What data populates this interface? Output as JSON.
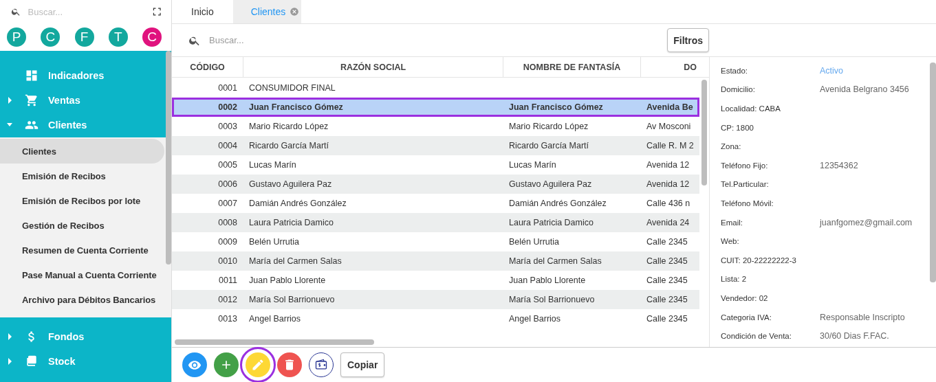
{
  "sidebar": {
    "search": {
      "placeholder": "Buscar..."
    },
    "shortcuts": [
      {
        "letter": "P",
        "color": "#13a89e"
      },
      {
        "letter": "C",
        "color": "#13a89e"
      },
      {
        "letter": "F",
        "color": "#13a89e"
      },
      {
        "letter": "T",
        "color": "#13a89e"
      },
      {
        "letter": "C",
        "color": "#e0137e"
      }
    ],
    "menu": [
      {
        "label": "Indicadores",
        "kind": "link"
      },
      {
        "label": "Ventas",
        "kind": "group",
        "expanded": false
      },
      {
        "label": "Clientes",
        "kind": "group",
        "expanded": true,
        "children": [
          {
            "label": "Clientes",
            "selected": true
          },
          {
            "label": "Emisión de Recibos",
            "selected": false
          },
          {
            "label": "Emisión de Recibos por lote",
            "selected": false
          },
          {
            "label": "Gestión de Recibos",
            "selected": false
          },
          {
            "label": "Resumen de Cuenta Corriente",
            "selected": false
          },
          {
            "label": "Pase Manual a Cuenta Corriente",
            "selected": false
          },
          {
            "label": "Archivo para Débitos Bancarios",
            "selected": false
          }
        ]
      },
      {
        "label": "Fondos",
        "kind": "group",
        "expanded": false
      },
      {
        "label": "Stock",
        "kind": "group",
        "expanded": false
      }
    ]
  },
  "tabs": [
    {
      "label": "Inicio",
      "selected": false,
      "closable": false
    },
    {
      "label": "Clientes",
      "selected": true,
      "closable": true
    }
  ],
  "search": {
    "placeholder": "Buscar..."
  },
  "filter_button": "Filtros",
  "table": {
    "columns": [
      "CÓDIGO",
      "RAZÓN SOCIAL",
      "NOMBRE DE FANTASÍA",
      "DO"
    ],
    "rows": [
      {
        "code": "0001",
        "razon": "CONSUMIDOR FINAL",
        "fantasia": "",
        "domicilio": "",
        "selected": false
      },
      {
        "code": "0002",
        "razon": "Juan Francisco Gómez",
        "fantasia": "Juan Francisco Gómez",
        "domicilio": "Avenida Be",
        "selected": true
      },
      {
        "code": "0003",
        "razon": "Mario Ricardo López",
        "fantasia": "Mario Ricardo López",
        "domicilio": "Av Mosconi",
        "selected": false
      },
      {
        "code": "0004",
        "razon": "Ricardo García Martí",
        "fantasia": "Ricardo García Martí",
        "domicilio": "Calle R. M 2",
        "selected": false
      },
      {
        "code": "0005",
        "razon": "Lucas Marín",
        "fantasia": "Lucas Marín",
        "domicilio": "Avenida 12",
        "selected": false
      },
      {
        "code": "0006",
        "razon": "Gustavo Aguilera Paz",
        "fantasia": "Gustavo Aguilera Paz",
        "domicilio": "Avenida 12",
        "selected": false
      },
      {
        "code": "0007",
        "razon": "Damián Andrés González",
        "fantasia": "Damián Andrés González",
        "domicilio": "Calle 436 n",
        "selected": false
      },
      {
        "code": "0008",
        "razon": "Laura Patricia Damico",
        "fantasia": "Laura Patricia Damico",
        "domicilio": "Avenida 24",
        "selected": false
      },
      {
        "code": "0009",
        "razon": "Belén Urrutia",
        "fantasia": "Belén Urrutia",
        "domicilio": "Calle 2345",
        "selected": false
      },
      {
        "code": "0010",
        "razon": "María del Carmen Salas",
        "fantasia": "María del Carmen Salas",
        "domicilio": "Calle 2345",
        "selected": false
      },
      {
        "code": "0011",
        "razon": "Juan Pablo Llorente",
        "fantasia": "Juan Pablo Llorente",
        "domicilio": "Calle 2345",
        "selected": false
      },
      {
        "code": "0012",
        "razon": "María Sol Barrionuevo",
        "fantasia": "María Sol Barrionuevo",
        "domicilio": "Calle 2345",
        "selected": false
      },
      {
        "code": "0013",
        "razon": "Angel Barrios",
        "fantasia": "Angel Barrios",
        "domicilio": "Calle 2345",
        "selected": false
      }
    ]
  },
  "details": [
    {
      "label": "Estado:",
      "value": "Activo",
      "kind": "status"
    },
    {
      "label": "Domicilio:",
      "value": "Avenida Belgrano 3456",
      "kind": "text"
    },
    {
      "label": "Localidad: CABA",
      "kind": "text"
    },
    {
      "label": "CP: 1800",
      "kind": "text"
    },
    {
      "label": "Zona:",
      "kind": "text"
    },
    {
      "label": "Teléfono Fijo:",
      "value": "12354362",
      "kind": "text"
    },
    {
      "label": "Tel.Particular:",
      "kind": "text"
    },
    {
      "label": "Teléfono Móvil:",
      "kind": "text"
    },
    {
      "label": "Email:",
      "value": "juanfgomez@gmail.com",
      "kind": "text"
    },
    {
      "label": "Web:",
      "kind": "text"
    },
    {
      "label": "CUIT: 20-22222222-3",
      "kind": "text"
    },
    {
      "label": "Lista: 2",
      "kind": "text"
    },
    {
      "label": "Vendedor: 02",
      "kind": "text"
    },
    {
      "label": "Categoria IVA:",
      "value": "Responsable Inscripto",
      "kind": "text"
    },
    {
      "label": "Condición de Venta:",
      "value": "30/60 Dias F.FAC.",
      "kind": "text"
    }
  ],
  "actions": [
    {
      "kind": "view",
      "highlighted": false
    },
    {
      "kind": "add",
      "highlighted": false
    },
    {
      "kind": "edit",
      "highlighted": true
    },
    {
      "kind": "delete",
      "highlighted": false
    },
    {
      "kind": "payment",
      "highlighted": false
    }
  ],
  "copy_button": "Copiar"
}
